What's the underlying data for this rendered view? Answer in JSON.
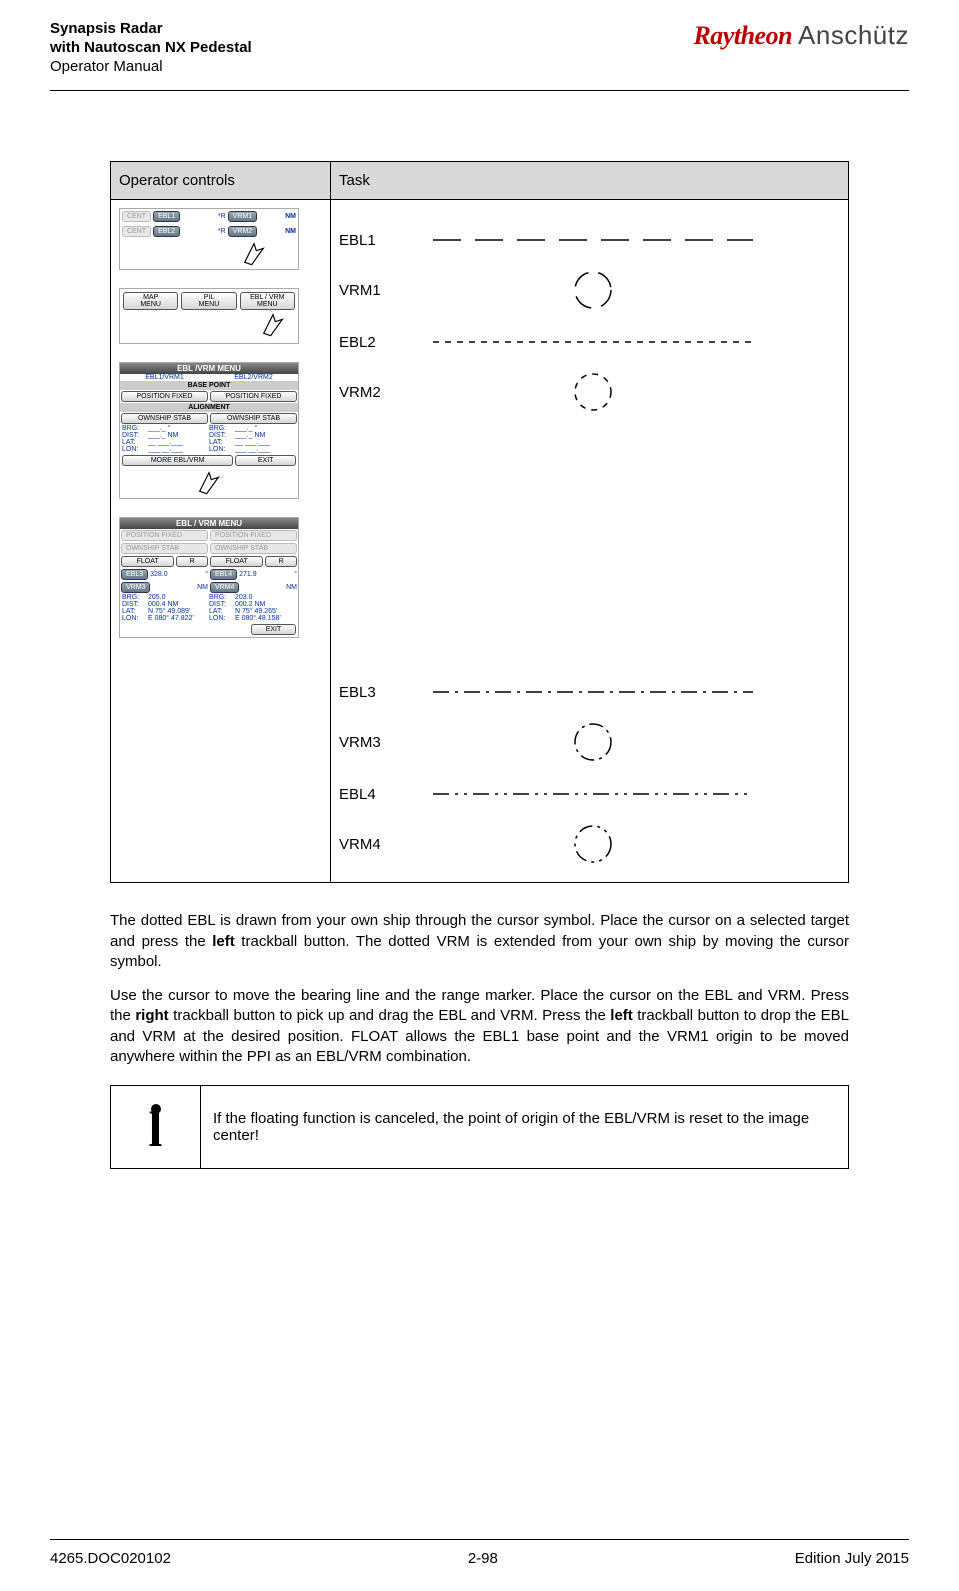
{
  "header": {
    "title1": "Synapsis Radar",
    "title2": "with Nautoscan NX Pedestal",
    "subtitle": "Operator Manual",
    "logo_left": "Raytheon",
    "logo_right": "Anschütz"
  },
  "table": {
    "col1": "Operator controls",
    "col2": "Task"
  },
  "panel1": {
    "cent": "CENT",
    "ebl1": "EBL1",
    "vrm1": "VRM1",
    "nm": "NM",
    "ebl2": "EBL2",
    "vrm2": "VRM2",
    "r_prefix": "*R"
  },
  "panel2": {
    "map": "MAP\nMENU",
    "pil": "PIL\nMENU",
    "ebl": "EBL / VRM\nMENU"
  },
  "panel3": {
    "title": "EBL /VRM MENU",
    "sub1": "EBL1/VRM1",
    "sub2": "EBL2/VRM2",
    "base": "BASE POINT",
    "posfix": "POSITION FIXED",
    "align": "ALIGNMENT",
    "own": "OWNSHIP STAB",
    "brg": "BRG:",
    "brgv": "___._  °",
    "dist": "DIST:",
    "distv": "___._  NM",
    "lat": "LAT:",
    "latv": "__ ___.___",
    "lon": "LON:",
    "lonv": "___ __.___",
    "more": "MORE EBL/VRM",
    "exit": "EXIT"
  },
  "panel4": {
    "title": "EBL / VRM MENU",
    "posfix": "POSITION FIXED",
    "own": "OWNSHIP STAB",
    "float": "FLOAT",
    "r": "R",
    "ebl3": "EBL3",
    "v_ebl3": "328.0",
    "deg": "°",
    "ebl4": "EBL4",
    "v_ebl4": "271.9",
    "vrm3": "VRM3",
    "nm": "NM",
    "vrm4": "VRM4",
    "brg": "BRG:",
    "brg1": "205.0",
    "brg2": "203.0",
    "dist": "DIST:",
    "dist1": "000.4",
    "dist2": "000.2",
    "lat": "LAT:",
    "lat1": "N 75° 49.089'",
    "lat2": "N 75° 49.265'",
    "lon": "LON:",
    "lon1": "E 080° 47.822'",
    "lon2": "E 080° 48.158'",
    "exit": "EXIT"
  },
  "legend": {
    "ebl1": "EBL1",
    "vrm1": "VRM1",
    "ebl2": "EBL2",
    "vrm2": "VRM2",
    "ebl3": "EBL3",
    "vrm3": "VRM3",
    "ebl4": "EBL4",
    "vrm4": "VRM4"
  },
  "para1_a": "The dotted EBL is drawn from your own ship through the cursor symbol. Place the cursor on a selected target and press the ",
  "para1_b": "left",
  "para1_c": " trackball button. The dotted VRM is extended from your own ship by moving the cursor symbol.",
  "para2_a": "Use the cursor to move the bearing line and the range marker. Place the cursor on the EBL and VRM. Press the ",
  "para2_b": "right",
  "para2_c": " trackball button to pick up and drag the EBL and VRM. Press the ",
  "para2_d": "left",
  "para2_e": " trackball button to drop the EBL and VRM at the desired position. FLOAT allows the EBL1 base point and the VRM1 origin to be moved anywhere within the PPI as an EBL/VRM combination.",
  "note": "If the floating function is canceled, the point of origin of the EBL/VRM is reset to the image center!",
  "footer": {
    "doc": "4265.DOC020102",
    "page": "2-98",
    "edition": "Edition July 2015"
  }
}
